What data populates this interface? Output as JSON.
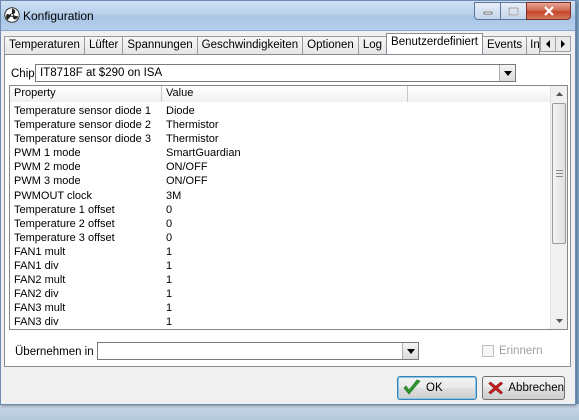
{
  "window": {
    "title": "Konfiguration"
  },
  "tabs": [
    {
      "label": "Temperaturen",
      "active": false
    },
    {
      "label": "Lüfter",
      "active": false
    },
    {
      "label": "Spannungen",
      "active": false
    },
    {
      "label": "Geschwindigkeiten",
      "active": false
    },
    {
      "label": "Optionen",
      "active": false
    },
    {
      "label": "Log",
      "active": false
    },
    {
      "label": "Benutzerdefiniert",
      "active": true
    },
    {
      "label": "Events",
      "active": false
    },
    {
      "label": "In",
      "active": false
    }
  ],
  "chip": {
    "label": "Chip",
    "value": "IT8718F at $290 on ISA"
  },
  "grid": {
    "columns": [
      "Property",
      "Value"
    ],
    "rows": [
      [
        "Temperature sensor diode 1",
        "Diode"
      ],
      [
        "Temperature sensor diode 2",
        "Thermistor"
      ],
      [
        "Temperature sensor diode 3",
        "Thermistor"
      ],
      [
        "PWM 1 mode",
        "SmartGuardian"
      ],
      [
        "PWM 2 mode",
        "ON/OFF"
      ],
      [
        "PWM 3 mode",
        "ON/OFF"
      ],
      [
        "PWMOUT clock",
        "3M"
      ],
      [
        "Temperature 1 offset",
        "0"
      ],
      [
        "Temperature 2 offset",
        "0"
      ],
      [
        "Temperature 3 offset",
        "0"
      ],
      [
        "FAN1 mult",
        "1"
      ],
      [
        "FAN1 div",
        "1"
      ],
      [
        "FAN2 mult",
        "1"
      ],
      [
        "FAN2 div",
        "1"
      ],
      [
        "FAN3 mult",
        "1"
      ],
      [
        "FAN3 div",
        "1"
      ]
    ]
  },
  "apply": {
    "label": "Übernehmen in",
    "value": ""
  },
  "remember": {
    "label": "Erinnern",
    "checked": false
  },
  "buttons": {
    "ok": "OK",
    "cancel": "Abbrechen"
  },
  "icons": {
    "app": "fan-icon",
    "ok": "checkmark-icon",
    "cancel": "red-x-icon"
  },
  "colors": {
    "title_bar": "#b9d1ec",
    "close_button": "#c7432b",
    "ok_check": "#2e9a2e",
    "cancel_x": "#c81e1e"
  }
}
